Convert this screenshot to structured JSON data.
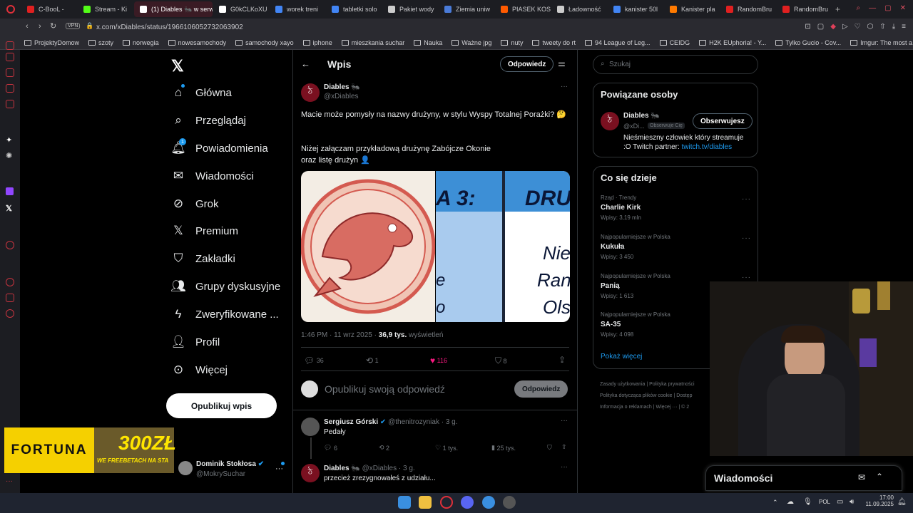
{
  "browser": {
    "tabs": [
      {
        "label": "C-BooL -",
        "color": "#e02020"
      },
      {
        "label": "Stream - Ki",
        "color": "#53fc18"
      },
      {
        "label": "(1) Diables 🐜 w serw",
        "color": "#ffffff",
        "active": true
      },
      {
        "label": "G0kCLKoXU",
        "color": "#ffffff"
      },
      {
        "label": "worek treni",
        "color": "#4285f4"
      },
      {
        "label": "tabletki solo",
        "color": "#4285f4"
      },
      {
        "label": "Pakiet wody",
        "color": "#cccccc"
      },
      {
        "label": "Ziemia uniw",
        "color": "#4a7bd8"
      },
      {
        "label": "PIASEK KOS",
        "color": "#ff5a00"
      },
      {
        "label": "Ładowność",
        "color": "#cccccc"
      },
      {
        "label": "kanister 50l",
        "color": "#4285f4"
      },
      {
        "label": "Kanister pla",
        "color": "#ff7a00"
      },
      {
        "label": "RandomBru",
        "color": "#e02020"
      },
      {
        "label": "RandomBru",
        "color": "#e02020"
      }
    ],
    "url": "x.com/xDiables/status/1966106052732063902",
    "vpn": "VPN",
    "bookmarks": [
      "ProjektyDomow",
      "szoty",
      "norwegia",
      "nowesamochody",
      "samochody xayo",
      "iphone",
      "mieszkania suchar",
      "Nauka",
      "Ważne jpg",
      "nuty",
      "tweety do rt",
      "94 League of Leg...",
      "CEIDG",
      "H2K EUphoria! - Y...",
      "Tylko Gucio - Cov...",
      "Imgur: The most a..."
    ]
  },
  "nav": {
    "items": [
      "Główna",
      "Przeglądaj",
      "Powiadomienia",
      "Wiadomości",
      "Grok",
      "Premium",
      "Zakładki",
      "Grupy dyskusyjne",
      "Zweryfikowane ...",
      "Profil",
      "Więcej"
    ],
    "notif_count": "1",
    "post_button": "Opublikuj wpis",
    "account_name": "Dominik Stokłosa",
    "account_handle": "@MokrySuchar"
  },
  "ad": {
    "brand": "FORTUNA",
    "amount": "300ZŁ",
    "tagline": "WE FREEBETACH NA STA"
  },
  "main": {
    "title": "Wpis",
    "reply_button": "Odpowiedz",
    "author_name": "Diables 🐜",
    "author_handle": "@xDiables",
    "text1": "Macie może pomysły na nazwy drużyny, w stylu Wyspy Totalnej Porażki? 🤔",
    "text2": "Niżej załączam przykładową drużynę Zabójcze Okonie",
    "text3": "oraz listę drużyn 👤",
    "image_text_a": "A 3:",
    "image_text_b": "DRU",
    "image_text_c": [
      "Nie",
      "Ran",
      "Ols"
    ],
    "image_text_d": [
      "e",
      "o"
    ],
    "time": "1:46 PM · 11 wrz 2025 ·",
    "views": "36,9 tys.",
    "views_label": "wyświetleń",
    "stats": {
      "replies": "36",
      "retweets": "1",
      "likes": "116",
      "bookmarks": "8"
    },
    "compose_placeholder": "Opublikuj swoją odpowiedź",
    "compose_button": "Odpowiedz",
    "replies": [
      {
        "name": "Sergiusz Górski",
        "handle": "@thenitrozyniak · 3 g.",
        "text": "Pedały",
        "stats": [
          "6",
          "2",
          "1 tys.",
          "25 tys."
        ]
      },
      {
        "name": "Diables 🐜",
        "handle": "@xDiables · 3 g.",
        "text": "przecież zrezygnowałeś z udziału..."
      }
    ]
  },
  "right": {
    "search_placeholder": "Szukaj",
    "related_title": "Powiązane osoby",
    "related_name": "Diables 🐜",
    "related_handle": "@xDi...",
    "follows_you": "Obserwuje Cię",
    "follow_button": "Obserwujesz",
    "related_bio": "Nieśmieszny człowiek który streamuje :O Twitch partner: ",
    "related_link": "twitch.tv/diables",
    "trends_title": "Co się dzieje",
    "trends": [
      {
        "cat": "Rząd · Trendy",
        "name": "Charlie Kirk",
        "count": "Wpisy: 3,19 mln"
      },
      {
        "cat": "Najpopularniejsze w Polska",
        "name": "Kukuła",
        "count": "Wpisy: 3 450"
      },
      {
        "cat": "Najpopularniejsze w Polska",
        "name": "Panią",
        "count": "Wpisy: 1 613"
      },
      {
        "cat": "Najpopularniejsze w Polska",
        "name": "SA-35",
        "count": "Wpisy: 4 098"
      }
    ],
    "show_more": "Pokaż więcej",
    "footer": [
      "Zasady użytkowania",
      "Polityka prywatności",
      "Polityka dotycząca plików cookie",
      "Dostęp",
      "Informacja o reklamach",
      "Więcej ···",
      "© 2"
    ],
    "messages": "Wiadomości"
  },
  "taskbar": {
    "lang": "POL",
    "time": "17:00",
    "date": "11.09.2025"
  }
}
